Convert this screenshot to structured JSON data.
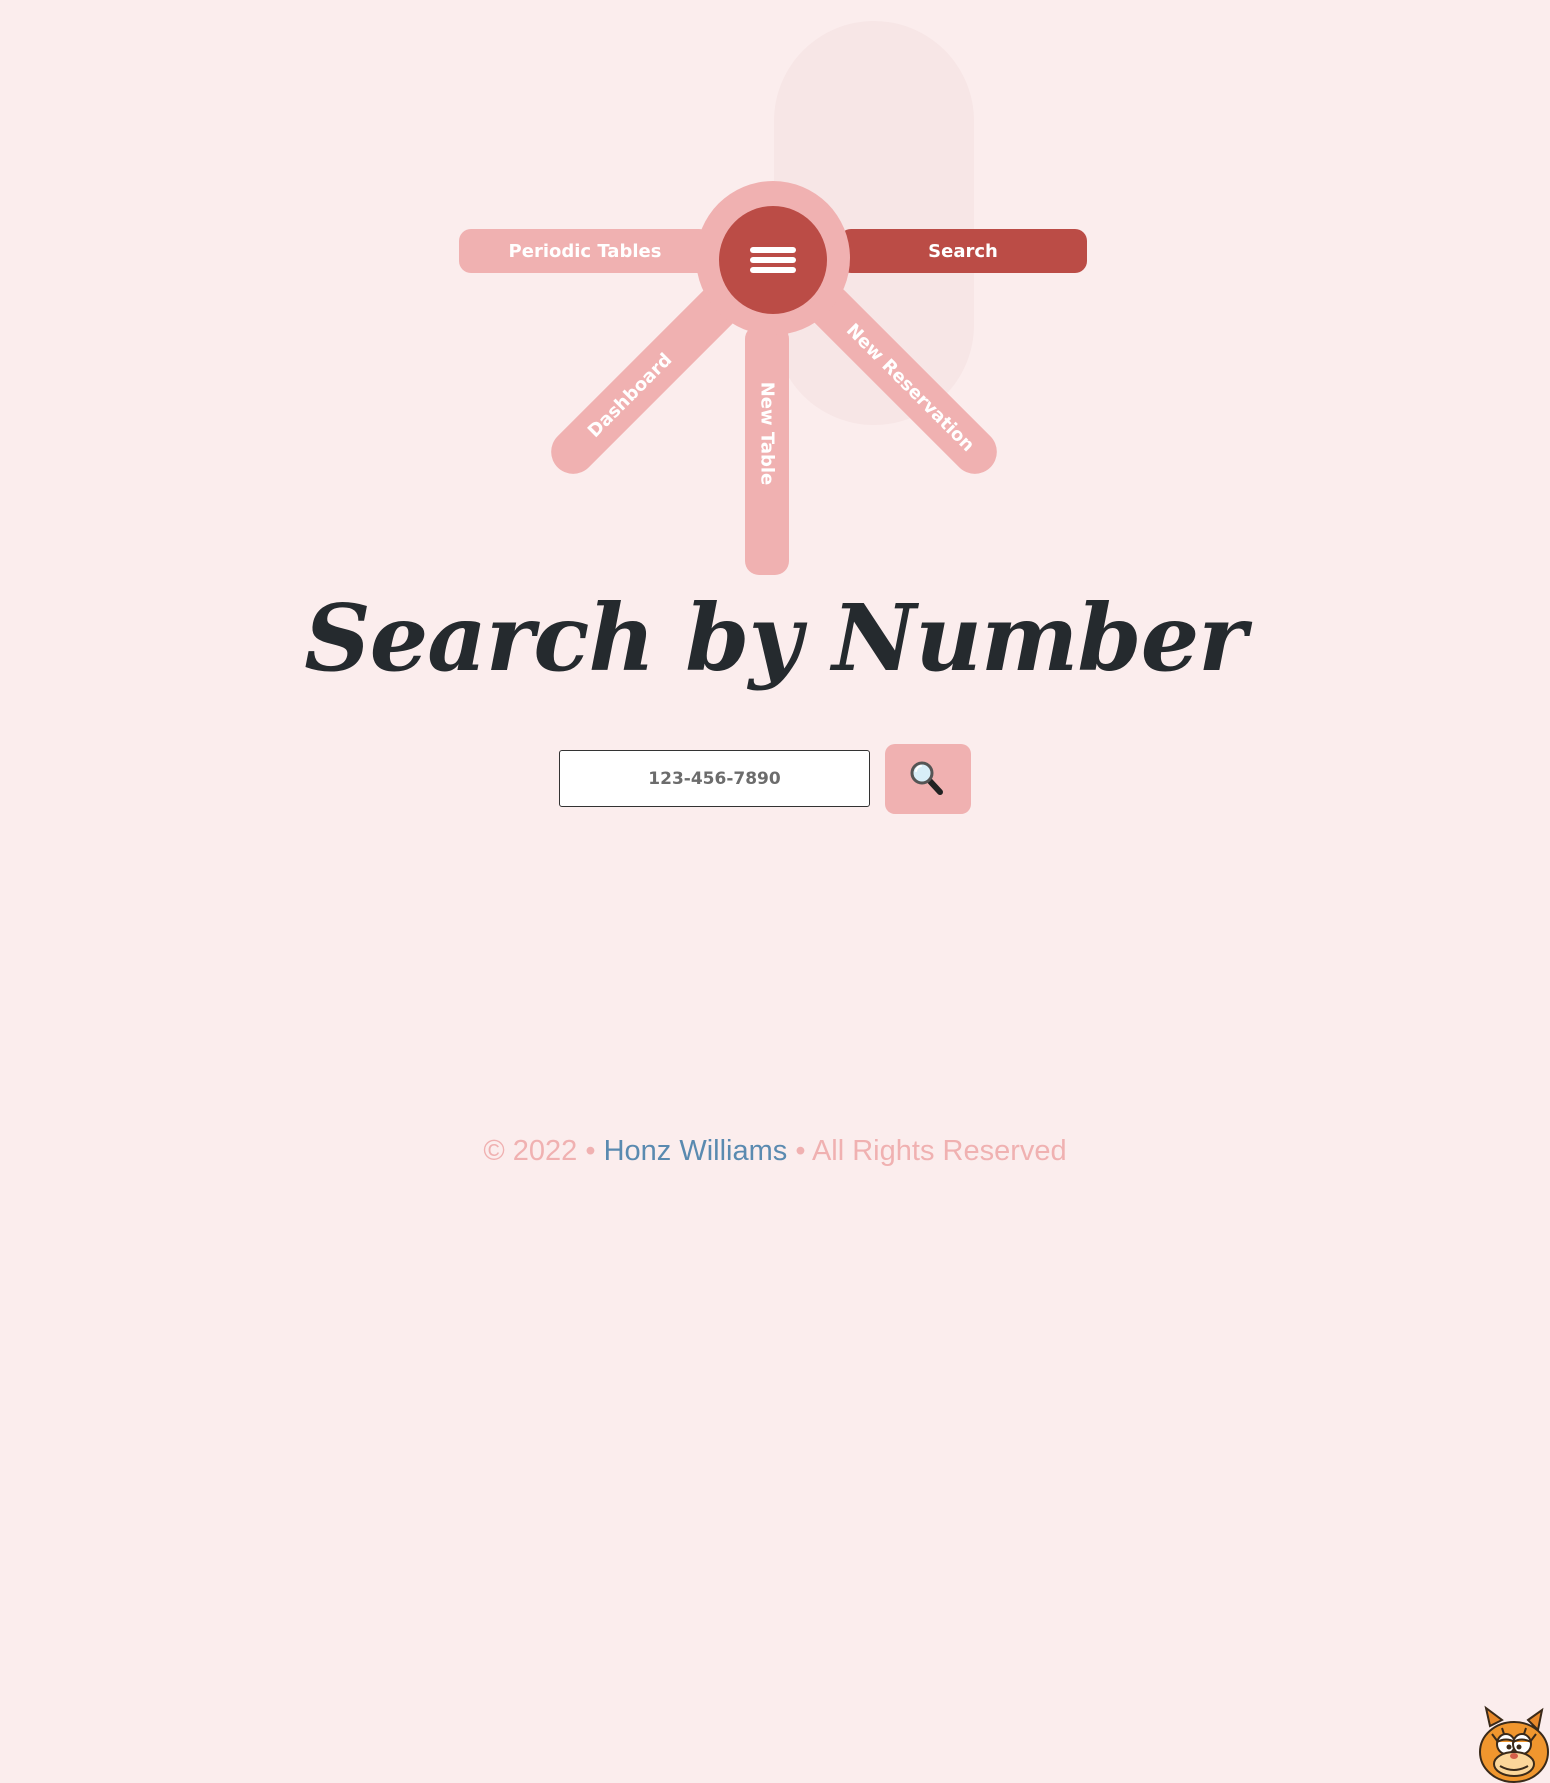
{
  "nav": {
    "periodic_tables": "Periodic Tables",
    "search": "Search",
    "dashboard": "Dashboard",
    "new_table": "New Table",
    "new_reservation": "New Reservation",
    "menu_icon": "hamburger-icon"
  },
  "main": {
    "title": "Search by Number",
    "search": {
      "placeholder": "123-456-7890",
      "value": "",
      "button_icon": "magnifying-glass-icon"
    }
  },
  "footer": {
    "copyright": "© 2022 •",
    "author": "Honz Williams",
    "rights": "• All Rights Reserved"
  },
  "colors": {
    "background": "#fbeded",
    "accent_light": "#f0b1b1",
    "accent_dark": "#bb4c46",
    "link": "#5a8ab0",
    "title": "#252a2e"
  }
}
